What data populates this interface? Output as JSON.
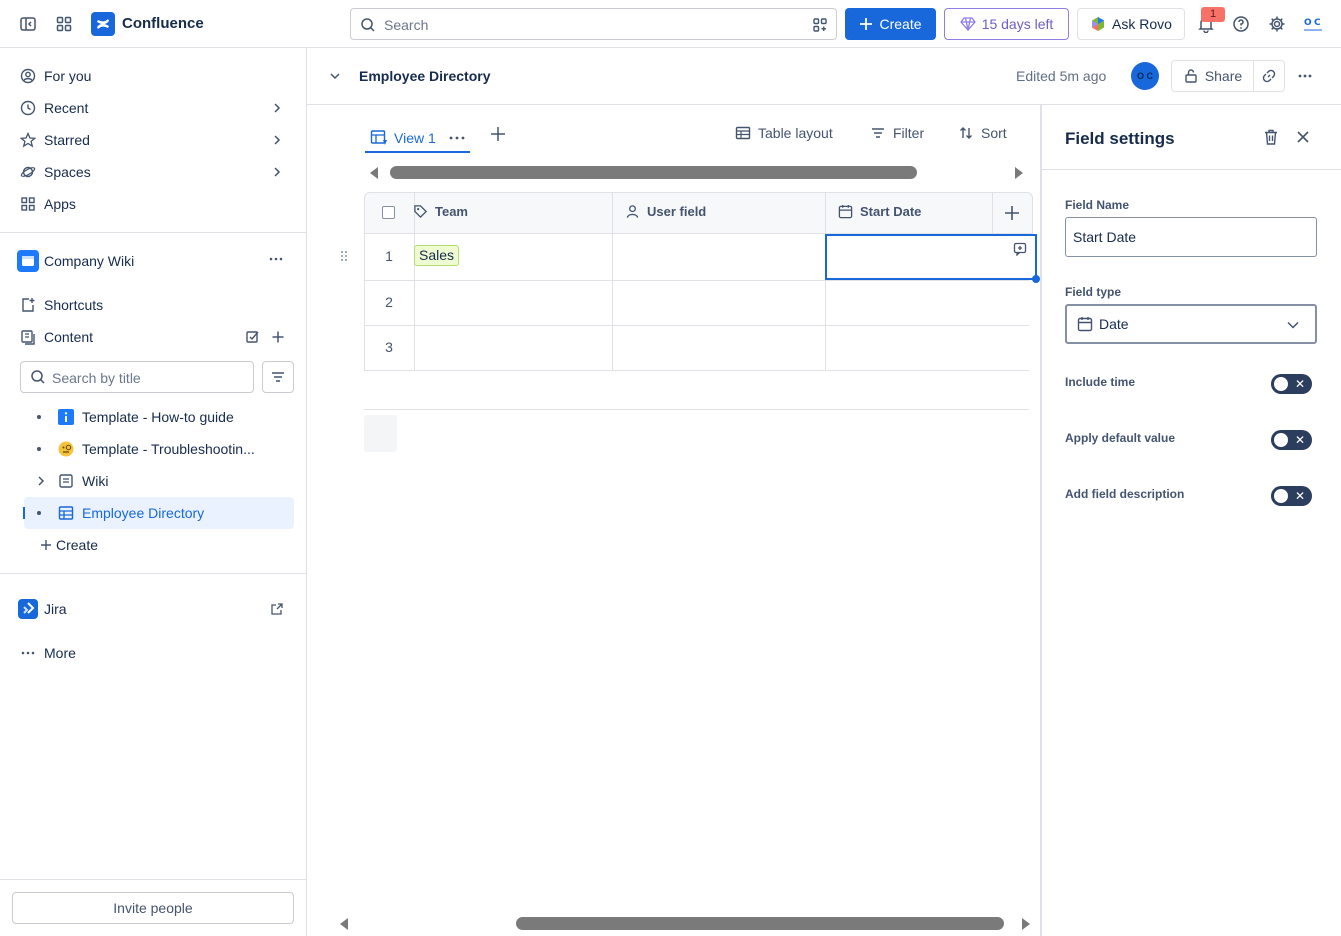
{
  "topbar": {
    "app_name": "Confluence",
    "search_placeholder": "Search",
    "create_label": "Create",
    "trial_label": "15 days left",
    "rovo_label": "Ask Rovo",
    "notification_count": "1"
  },
  "sidebar": {
    "nav": [
      {
        "label": "For you"
      },
      {
        "label": "Recent"
      },
      {
        "label": "Starred"
      },
      {
        "label": "Spaces"
      },
      {
        "label": "Apps"
      }
    ],
    "space_name": "Company Wiki",
    "shortcuts_label": "Shortcuts",
    "content_label": "Content",
    "search_placeholder": "Search by title",
    "tree": [
      {
        "label": "Template - How-to guide"
      },
      {
        "label": "Template - Troubleshootin..."
      },
      {
        "label": "Wiki"
      },
      {
        "label": "Employee Directory"
      }
    ],
    "create_label": "Create",
    "jira_label": "Jira",
    "more_label": "More",
    "invite_label": "Invite people"
  },
  "page": {
    "title": "Employee Directory",
    "edited": "Edited 5m ago",
    "avatar_initials": "O C",
    "share_label": "Share"
  },
  "database": {
    "view_label": "View 1",
    "toolbar": {
      "layout_label": "Table layout",
      "filter_label": "Filter",
      "sort_label": "Sort"
    },
    "columns": [
      "Team",
      "User field",
      "Start Date"
    ],
    "rows": [
      {
        "num": "1",
        "team": "Sales"
      },
      {
        "num": "2",
        "team": ""
      },
      {
        "num": "3",
        "team": ""
      }
    ]
  },
  "field_settings": {
    "title": "Field settings",
    "field_name_label": "Field Name",
    "field_name_value": "Start Date",
    "field_type_label": "Field type",
    "field_type_value": "Date",
    "toggles": [
      {
        "label": "Include time",
        "on": false
      },
      {
        "label": "Apply default value",
        "on": false
      },
      {
        "label": "Add field description",
        "on": false
      }
    ]
  },
  "colors": {
    "accent": "#1868db",
    "trial": "#6e5dc6",
    "tag_bg": "#effcd2"
  }
}
